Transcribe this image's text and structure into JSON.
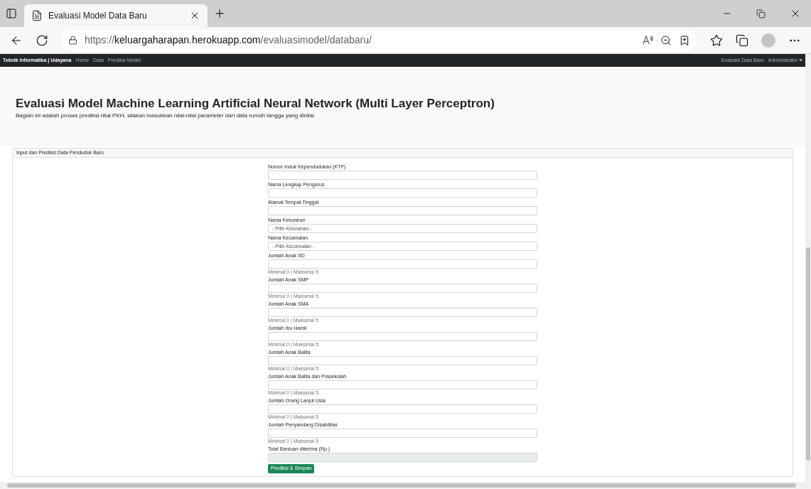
{
  "browser": {
    "tab_title": "Evaluasi Model Data Baru",
    "url_prefix": "https://",
    "url_host": "keluargaharapan.herokuapp.com",
    "url_path": "/evaluasimodel/databaru/"
  },
  "navbar": {
    "brand": "Teknik Informatika | Udayana",
    "links": [
      "Home",
      "Data",
      "Prediksi Model"
    ],
    "right_links": [
      "Evaluasi Data Baru",
      "Administrator"
    ]
  },
  "header": {
    "title": "Evaluasi Model Machine Learning Artificial Neural Network (Multi Layer Perceptron)",
    "subtitle": "Bagian ini adalah proses prediksi nilai PKH, silakan masukkan nilai-nilai parameter dari data rumah tangga yang dinilai"
  },
  "card": {
    "title": "Input dan Prediksi Data Penduduk Baru",
    "fields": [
      {
        "kind": "text",
        "label": "Nomor Induk Kependudukan (KTP)"
      },
      {
        "kind": "text",
        "label": "Nama Lengkap Pengurus"
      },
      {
        "kind": "text",
        "label": "Alamat Tempat Tinggal"
      },
      {
        "kind": "select",
        "label": "Nama Kelurahan",
        "placeholder": "- Pilih Kelurahan -"
      },
      {
        "kind": "select",
        "label": "Nama Kecamatan",
        "placeholder": "- Pilih Kecamatan -"
      },
      {
        "kind": "number",
        "label": "Jumlah Anak SD",
        "help": "Minimal 0 | Maksimal 5"
      },
      {
        "kind": "number",
        "label": "Jumlah Anak SMP",
        "help": "Minimal 0 | Maksimal 5"
      },
      {
        "kind": "number",
        "label": "Jumlah Anak SMA",
        "help": "Minimal 0 | Maksimal 5"
      },
      {
        "kind": "number",
        "label": "Jumlah Ibu Hamil",
        "help": "Minimal 0 | Maksimal 5"
      },
      {
        "kind": "number",
        "label": "Jumlah Anak Balita",
        "help": "Minimal 0 | Maksimal 5"
      },
      {
        "kind": "number",
        "label": "Jumlah Anak Balita dan Prasekolah",
        "help": "Minimal 0 | Maksimal 5"
      },
      {
        "kind": "number",
        "label": "Jumlah Orang Lanjut Usia",
        "help": "Minimal 0 | Maksimal 5"
      },
      {
        "kind": "number",
        "label": "Jumlah Penyandang Disabilitas",
        "help": "Minimal 0 | Maksimal 5"
      },
      {
        "kind": "readonly",
        "label": "Total Bantuan diterima (Rp.)"
      }
    ],
    "submit": "Prediksi & Simpan"
  }
}
